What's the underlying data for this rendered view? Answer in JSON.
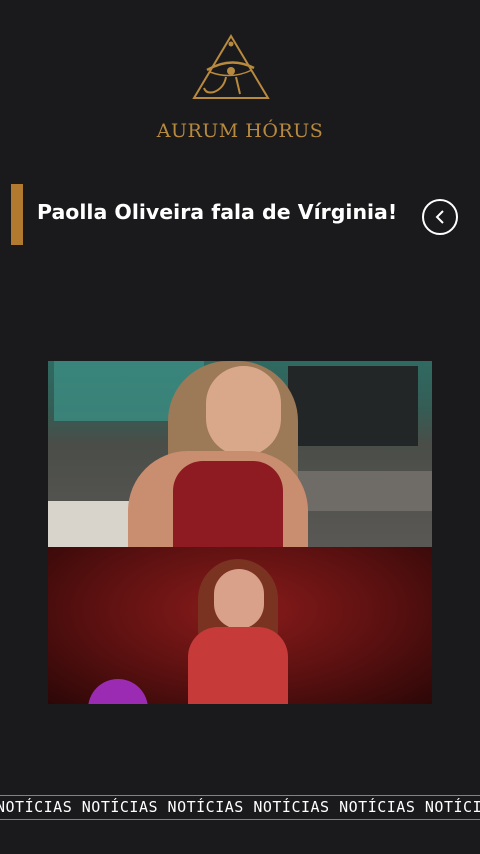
{
  "brand": {
    "name": "AURUM HÓRUS"
  },
  "header": {
    "title": "Paolla Oliveira fala de Vírginia!"
  },
  "back_button": {
    "icon": "chevron-left-icon"
  },
  "media": {
    "type": "video",
    "overlay_badge_icon": "channel-badge-icon"
  },
  "ticker": {
    "text": "NOTÍCIAS NOTÍCIAS NOTÍCIAS NOTÍCIAS NOTÍCIAS NOTÍCIAS"
  },
  "colors": {
    "background": "#1a191b",
    "accent": "#b27a2f",
    "brand_text": "#b88a3e",
    "text": "#ffffff"
  }
}
